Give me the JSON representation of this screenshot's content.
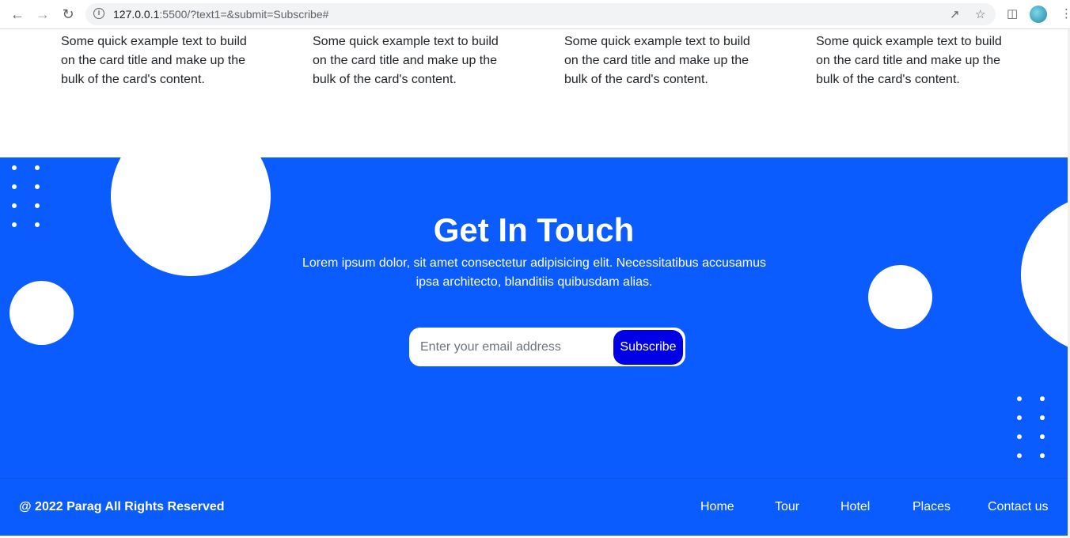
{
  "browser": {
    "url_host": "127.0.0.1",
    "url_rest": ":5500/?text1=&submit=Subscribe#"
  },
  "cards": [
    {
      "text": "Some quick example text to build on the card title and make up the bulk of the card's content."
    },
    {
      "text": "Some quick example text to build on the card title and make up the bulk of the card's content."
    },
    {
      "text": "Some quick example text to build on the card title and make up the bulk of the card's content."
    },
    {
      "text": "Some quick example text to build on the card title and make up the bulk of the card's content."
    }
  ],
  "contact": {
    "title": "Get In Touch",
    "description": "Lorem ipsum dolor, sit amet consectetur adipisicing elit. Necessitatibus accusamus ipsa architecto, blanditiis quibusdam alias.",
    "email_placeholder": "Enter your email address",
    "subscribe_label": "Subscribe"
  },
  "footer": {
    "copyright": "@ 2022 Parag All Rights Reserved",
    "links": [
      "Home",
      "Tour",
      "Hotel",
      "Places",
      "Contact us"
    ]
  },
  "colors": {
    "section_blue": "#0b5cff",
    "button_blue": "#0000e6"
  }
}
